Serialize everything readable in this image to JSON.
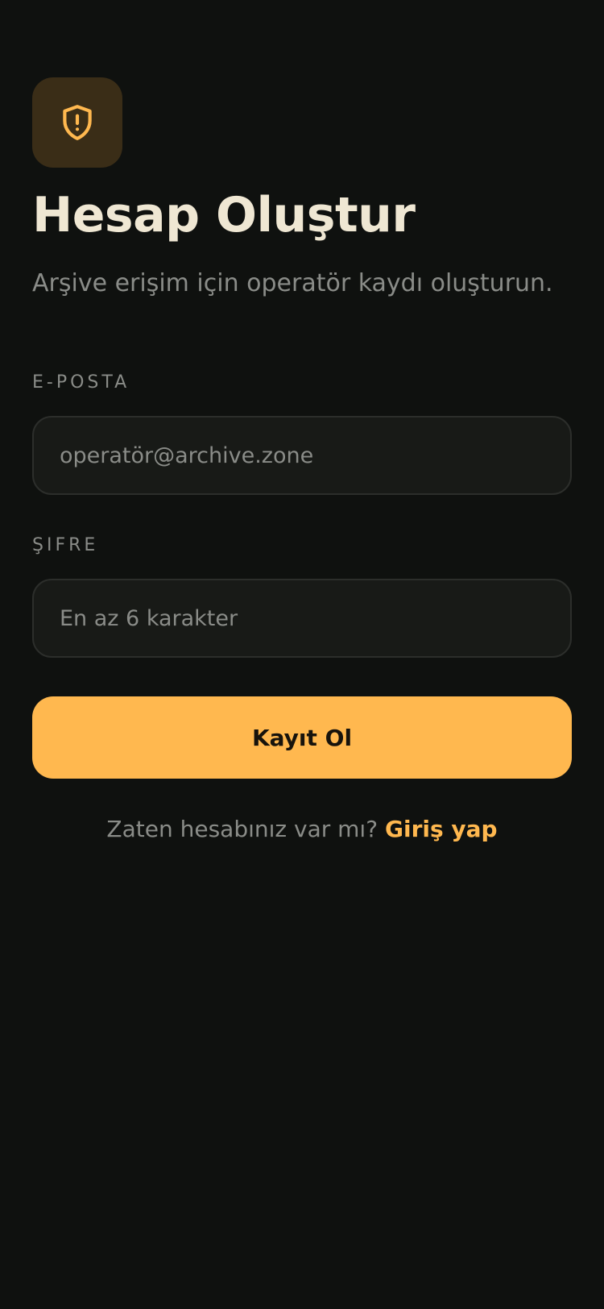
{
  "colors": {
    "background": "#0f110f",
    "accent": "#ffb84f",
    "logo_tile": "#3a2d17",
    "title": "#efe7d3",
    "muted": "#8a8c88"
  },
  "logo": {
    "icon": "shield-alert-icon"
  },
  "header": {
    "title": "Hesap Oluştur",
    "subtitle": "Arşive erişim için operatör kaydı oluşturun."
  },
  "form": {
    "email": {
      "label": "E-POSTA",
      "value": "",
      "placeholder": "operatör@archive.zone"
    },
    "password": {
      "label": "ŞIFRE",
      "value": "",
      "placeholder": "En az 6 karakter"
    },
    "submit_label": "Kayıt Ol"
  },
  "footer": {
    "prompt": "Zaten hesabınız var mı?",
    "link": "Giriş yap"
  }
}
